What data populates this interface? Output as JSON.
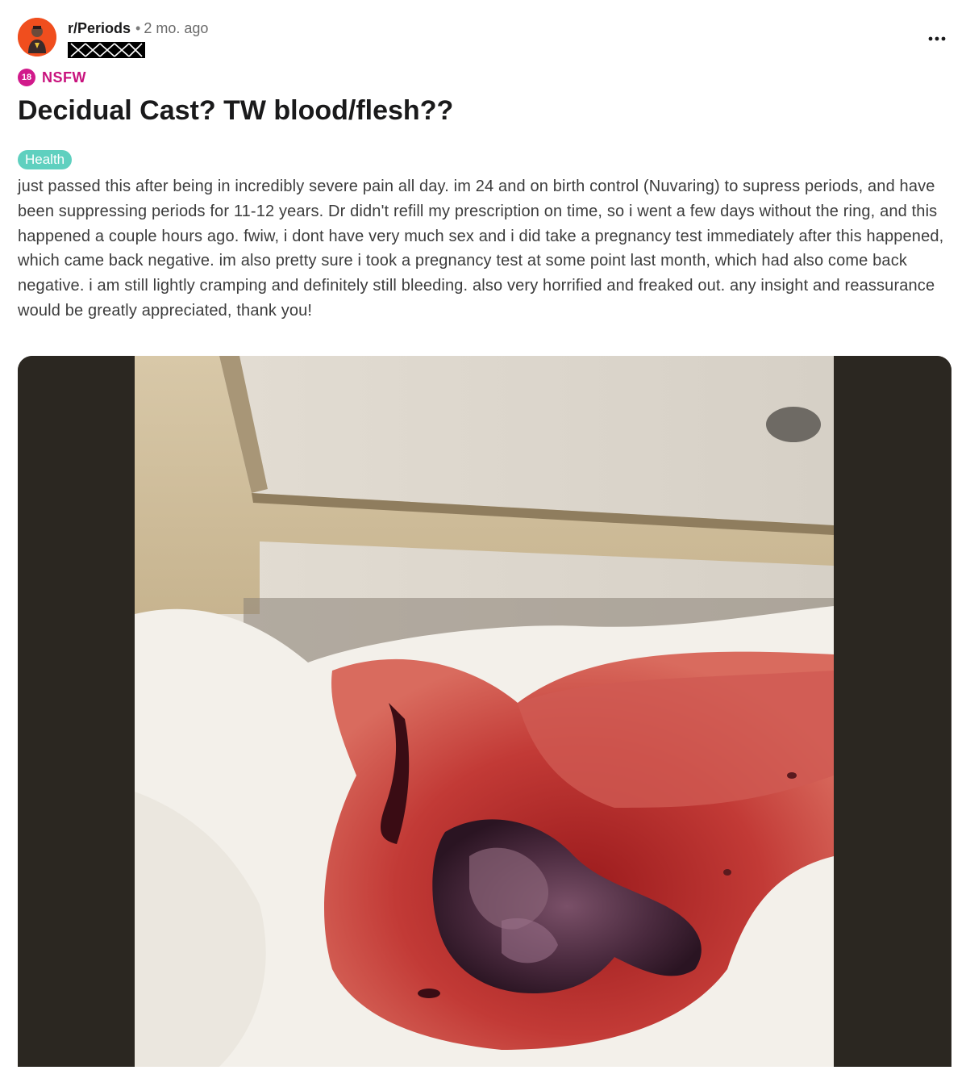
{
  "post": {
    "subreddit": "r/Periods",
    "separator": "•",
    "time_ago": "2 mo. ago",
    "nsfw_badge": "18",
    "nsfw_label": "NSFW",
    "title": "Decidual Cast? TW blood/flesh??",
    "flair": "Health",
    "body": "just passed this after being in incredibly severe pain all day. im 24 and on birth control (Nuvaring) to supress periods, and have been suppressing periods for 11-12 years. Dr didn't refill my prescription on time, so i went a few days without the ring, and this happened a couple hours ago. fwiw, i dont have very much sex and i did take a pregnancy test immediately after this happened, which came back negative. im also pretty sure i took a pregnancy test at some point last month, which had also come back negative. i am still lightly cramping and definitely still bleeding. also very horrified and freaked out. any insight and reassurance would be greatly appreciated, thank you!"
  },
  "icons": {
    "avatar": "subreddit-avatar-icon",
    "more": "more-options-icon"
  },
  "colors": {
    "nsfw": "#c8127d",
    "flair_bg": "#5fd0bf",
    "avatar_bg": "#f04e1e"
  }
}
